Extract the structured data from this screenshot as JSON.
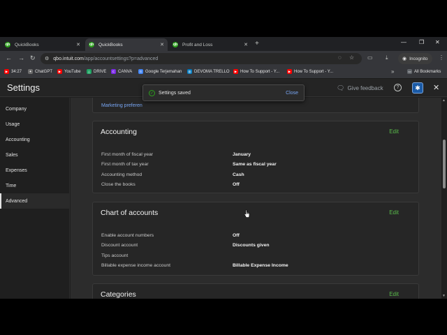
{
  "browser": {
    "tabs": [
      {
        "label": "QuickBooks",
        "active": false
      },
      {
        "label": "QuickBooks",
        "active": true
      },
      {
        "label": "Profit and Loss",
        "active": false
      }
    ],
    "url_host": "qbo.intuit.com",
    "url_path": "/app/accountsettings?p=advanced",
    "incognito_label": "Incognito",
    "bookmarks": [
      {
        "label": "34:27",
        "icon": "youtube-icon",
        "color": "#ff0000"
      },
      {
        "label": "ChatGPT",
        "icon": "chatgpt-icon",
        "color": "#6b6b6b"
      },
      {
        "label": "YouTube",
        "icon": "youtube-icon",
        "color": "#ff0000"
      },
      {
        "label": "DRIVE",
        "icon": "drive-icon",
        "color": "#1fa463"
      },
      {
        "label": "CANVA",
        "icon": "canva-icon",
        "color": "#7d2ae8"
      },
      {
        "label": "Google Terjemahan",
        "icon": "translate-icon",
        "color": "#4285f4"
      },
      {
        "label": "DEVOMA TRELLO",
        "icon": "trello-icon",
        "color": "#0079bf"
      },
      {
        "label": "How To Support - Y...",
        "icon": "youtube-icon",
        "color": "#ff0000"
      },
      {
        "label": "How To Support - Y...",
        "icon": "youtube-icon",
        "color": "#ff0000"
      }
    ],
    "all_bookmarks_label": "All Bookmarks"
  },
  "header": {
    "title": "Settings",
    "feedback_label": "Give feedback"
  },
  "toast": {
    "message": "Settings saved",
    "close_label": "Close"
  },
  "sidebar": {
    "items": [
      {
        "label": "Company",
        "active": false
      },
      {
        "label": "Usage",
        "active": false
      },
      {
        "label": "Accounting",
        "active": false
      },
      {
        "label": "Sales",
        "active": false
      },
      {
        "label": "Expenses",
        "active": false
      },
      {
        "label": "Time",
        "active": false
      },
      {
        "label": "Advanced",
        "active": true
      }
    ]
  },
  "main": {
    "top_card_link": "Marketing preferen",
    "sections": [
      {
        "title": "Accounting",
        "edit_label": "Edit",
        "rows": [
          {
            "label": "First month of fiscal year",
            "value": "January"
          },
          {
            "label": "First month of tax year",
            "value": "Same as fiscal year"
          },
          {
            "label": "Accounting method",
            "value": "Cash"
          },
          {
            "label": "Close the books",
            "value": "Off"
          }
        ]
      },
      {
        "title": "Chart of accounts",
        "edit_label": "Edit",
        "rows": [
          {
            "label": "Enable account numbers",
            "value": "Off"
          },
          {
            "label": "Discount account",
            "value": "Discounts given"
          },
          {
            "label": "Tips account",
            "value": ""
          },
          {
            "label": "Billable expense income account",
            "value": "Billable Expense Income"
          }
        ]
      },
      {
        "title": "Categories",
        "edit_label": "Edit",
        "rows": []
      }
    ]
  },
  "colors": {
    "accent_green": "#58b94a",
    "link_blue": "#79a7f5",
    "gear_blue": "#1a5aa6"
  }
}
